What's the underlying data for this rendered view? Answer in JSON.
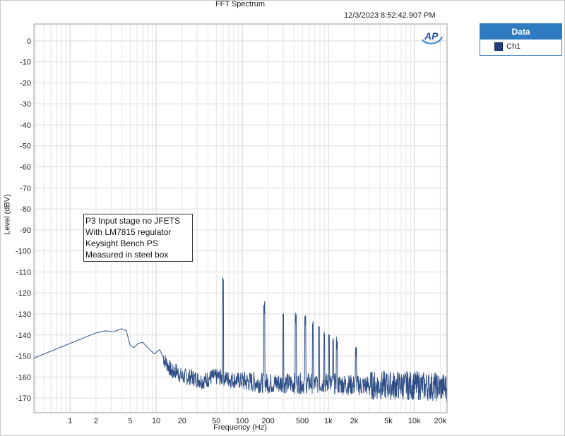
{
  "chart_data": {
    "type": "line",
    "title": "FFT Spectrum",
    "timestamp": "12/3/2023 8:52:42.907 PM",
    "xlabel": "Frequency (Hz)",
    "ylabel": "Level (dBV)",
    "x_scale": "log",
    "xlim": [
      0.38,
      24000
    ],
    "ylim": [
      -177,
      8
    ],
    "grid": true,
    "x_ticks": [
      1,
      2,
      5,
      10,
      20,
      50,
      100,
      200,
      500,
      1000,
      2000,
      5000,
      10000,
      20000
    ],
    "x_tick_labels": [
      "1",
      "2",
      "5",
      "10",
      "20",
      "50",
      "100",
      "200",
      "500",
      "1k",
      "2k",
      "5k",
      "10k",
      "20k"
    ],
    "y_ticks": [
      0,
      -10,
      -20,
      -30,
      -40,
      -50,
      -60,
      -70,
      -80,
      -90,
      -100,
      -110,
      -120,
      -130,
      -140,
      -150,
      -160,
      -170
    ],
    "legend": {
      "header": "Data",
      "position": "right",
      "entries": [
        "Ch1"
      ]
    },
    "annotation": [
      "P3 Input stage no JFETS",
      "With LM7815 regulator",
      "Keysight Bench PS",
      "Measured in steel box"
    ],
    "series": [
      {
        "name": "Ch1",
        "color": "#2f4f86",
        "floor_points": [
          [
            0.38,
            -151
          ],
          [
            2.0,
            -139
          ],
          [
            2.6,
            -138
          ],
          [
            3.2,
            -138.5
          ],
          [
            4.0,
            -137
          ],
          [
            4.5,
            -138
          ],
          [
            5.0,
            -145
          ],
          [
            5.5,
            -146
          ],
          [
            6.2,
            -144
          ],
          [
            7.0,
            -143.5
          ],
          [
            8.0,
            -146
          ],
          [
            9.5,
            -149
          ],
          [
            11.0,
            -147
          ],
          [
            12.5,
            -152
          ],
          [
            14.0,
            -155
          ],
          [
            15.5,
            -158
          ],
          [
            17.0,
            -157
          ],
          [
            20.0,
            -160
          ],
          [
            25.0,
            -160
          ],
          [
            30.0,
            -161
          ],
          [
            35.0,
            -162
          ],
          [
            40.0,
            -161
          ],
          [
            45.0,
            -160
          ],
          [
            52.0,
            -160
          ],
          [
            70.0,
            -161
          ],
          [
            100.0,
            -162
          ],
          [
            200.0,
            -163
          ],
          [
            500.0,
            -163
          ],
          [
            1000.0,
            -163
          ],
          [
            2000.0,
            -164
          ],
          [
            5000.0,
            -164
          ],
          [
            10000.0,
            -164
          ],
          [
            24000.0,
            -165
          ]
        ],
        "peaks": [
          [
            60,
            -117
          ],
          [
            180,
            -131
          ],
          [
            300,
            -134
          ],
          [
            420,
            -136
          ],
          [
            540,
            -137
          ],
          [
            660,
            -138
          ],
          [
            780,
            -140
          ],
          [
            900,
            -143
          ],
          [
            1020,
            -144
          ],
          [
            1140,
            -146
          ],
          [
            1260,
            -148
          ],
          [
            2100,
            -152
          ]
        ]
      }
    ]
  }
}
